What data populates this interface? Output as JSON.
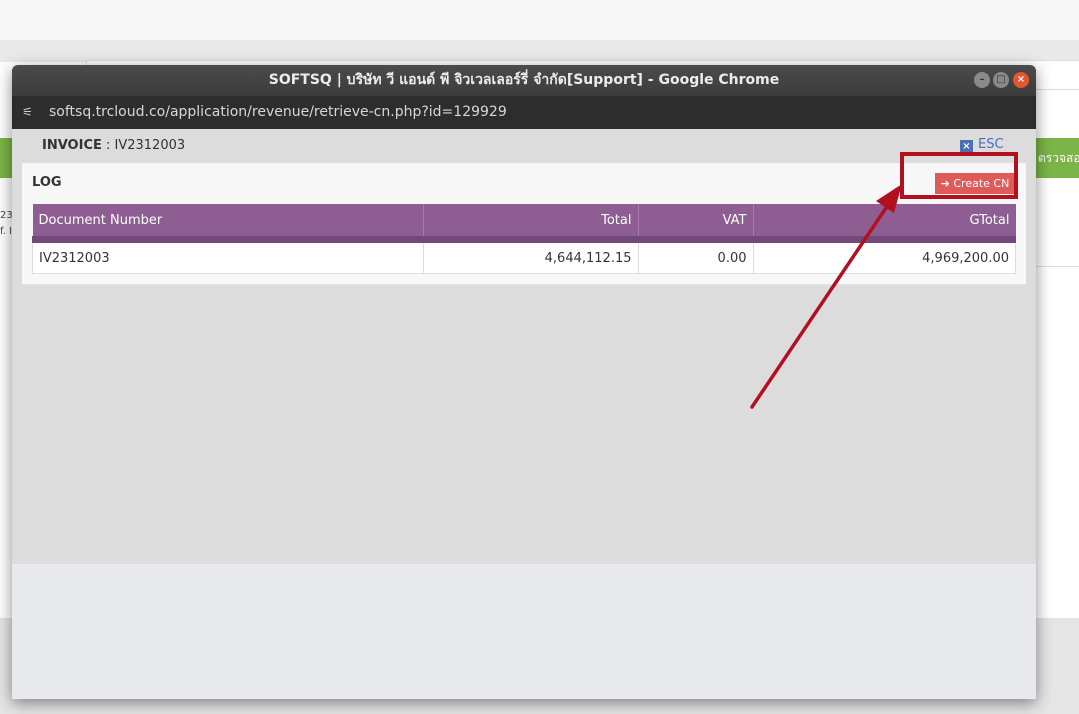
{
  "background": {
    "green_button_label": "ตรวจสอบ",
    "side_text_1": "23",
    "side_text_2": "f. I"
  },
  "window": {
    "title": "SOFTSQ | บริษัท วี แอนด์ พี จิวเวลเลอร์รี่ จำกัด[Support] - Google Chrome",
    "url": "softsq.trcloud.co/application/revenue/retrieve-cn.php?id=129929",
    "minimize_icon": "minimize-icon",
    "maximize_icon": "maximize-icon",
    "close_icon": "close-icon"
  },
  "invoice": {
    "label": "INVOICE",
    "separator": " : ",
    "number": "IV2312003"
  },
  "esc": {
    "label": "ESC"
  },
  "log": {
    "title": "LOG",
    "create_button": "Create CN",
    "columns": [
      "Document Number",
      "Total",
      "VAT",
      "GTotal"
    ],
    "rows": [
      [
        "IV2312003",
        "4,644,112.15",
        "0.00",
        "4,969,200.00"
      ]
    ]
  },
  "colors": {
    "header_purple": "#8e5e93",
    "create_button": "#e05a5a",
    "annotation_red": "#b3101f",
    "green": "#7bb547"
  }
}
